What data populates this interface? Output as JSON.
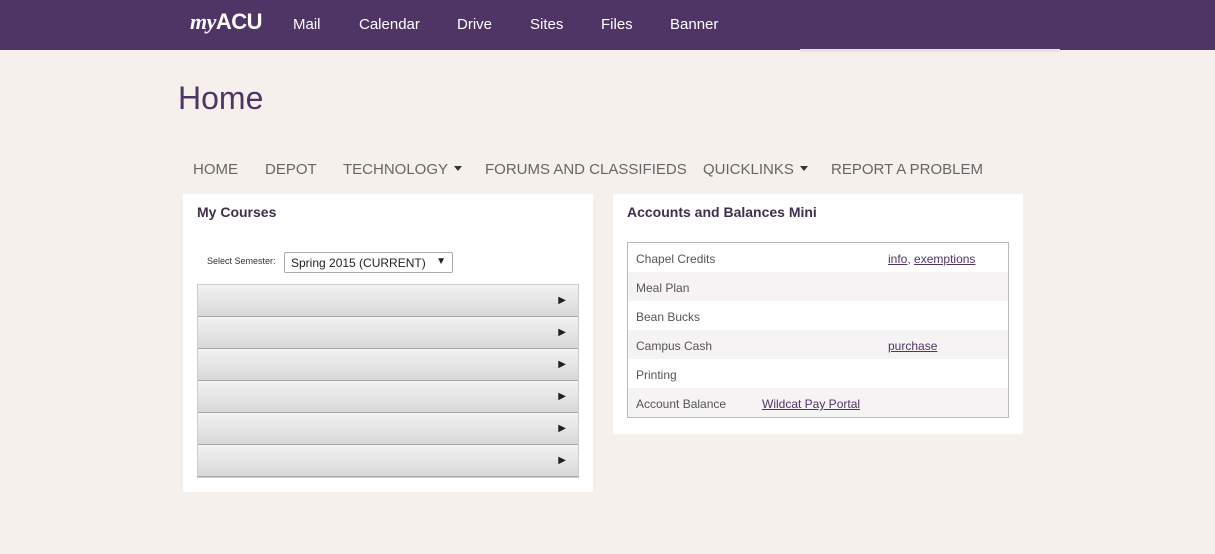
{
  "topbar": {
    "logo_my": "my",
    "logo_acu": "ACU",
    "links": [
      "Mail",
      "Calendar",
      "Drive",
      "Sites",
      "Files",
      "Banner"
    ]
  },
  "page_title": "Home",
  "main_nav": {
    "home": "HOME",
    "depot": "DEPOT",
    "technology": "TECHNOLOGY",
    "forums": "FORUMS AND CLASSIFIEDS",
    "quicklinks": "QUICKLINKS",
    "report": "REPORT A PROBLEM"
  },
  "courses": {
    "title": "My Courses",
    "semester_label": "Select Semester:",
    "semester_value": "Spring 2015 (CURRENT)",
    "row_count": 6
  },
  "balances": {
    "title": "Accounts and Balances Mini",
    "rows": [
      {
        "label": "Chapel Credits",
        "link1": "info",
        "sep": ",",
        "link2": "exemptions"
      },
      {
        "label": "Meal Plan"
      },
      {
        "label": "Bean Bucks"
      },
      {
        "label": "Campus Cash",
        "link1": "purchase"
      },
      {
        "label": "Printing"
      },
      {
        "label": "Account Balance",
        "mid_link": "Wildcat Pay Portal"
      }
    ]
  },
  "colors": {
    "brand_purple": "#4e3566",
    "background": "#f5f0eb"
  }
}
